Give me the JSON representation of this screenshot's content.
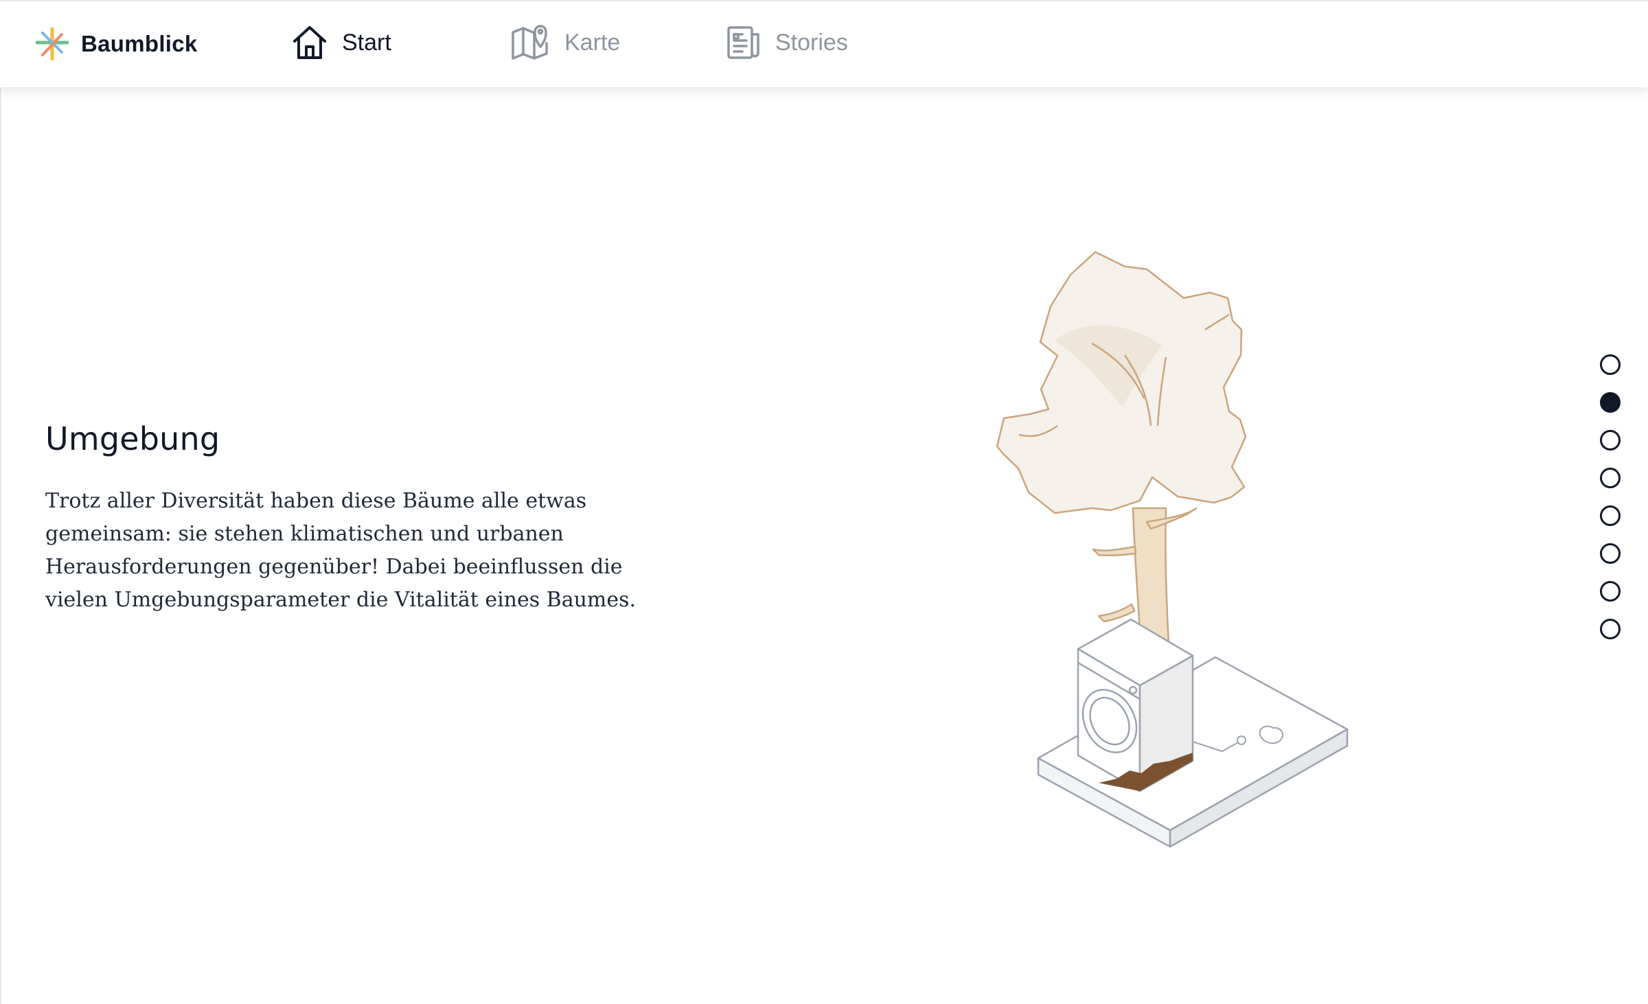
{
  "nav": {
    "brand": "Baumblick",
    "items": [
      {
        "label": "Start",
        "icon": "home-icon",
        "active": true
      },
      {
        "label": "Karte",
        "icon": "map-pin-icon",
        "active": false
      },
      {
        "label": "Stories",
        "icon": "newspaper-icon",
        "active": false
      }
    ]
  },
  "section": {
    "title": "Umgebung",
    "body": "Trotz aller Diversität haben diese Bäume alle etwas gemeinsam: sie stehen klimatischen und urbanen Herausforderungen gegenüber! Dabei beeinflussen die vielen Umgebungsparameter die Vitalität eines Baumes."
  },
  "pagination": {
    "total": 8,
    "active_index": 1
  },
  "illustration": {
    "subject": "tree-with-washing-machine",
    "palette": {
      "tree": "#f0dfc5",
      "outline": "#c9a57c",
      "crown": "#f6f1ea",
      "box": "#9ca3af",
      "soil": "#7a5230"
    }
  },
  "colors": {
    "text": "#111827",
    "inactive": "#8e949d",
    "logo": [
      "#f5b942",
      "#6dbf8b",
      "#7fb5e0",
      "#f08a6a"
    ]
  }
}
